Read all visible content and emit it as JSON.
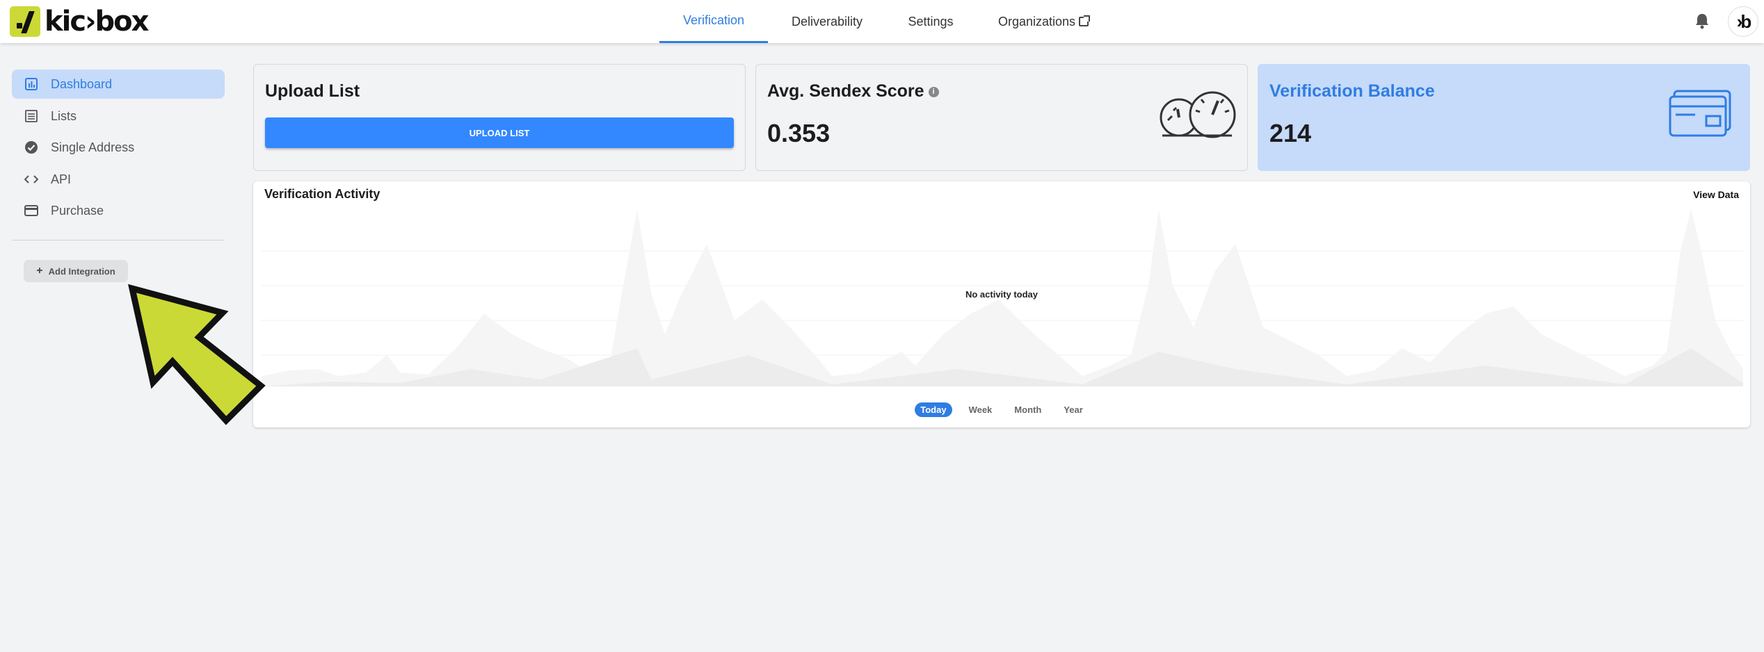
{
  "header": {
    "logo_text": "kic›box",
    "nav": [
      {
        "label": "Verification",
        "active": true
      },
      {
        "label": "Deliverability",
        "active": false
      },
      {
        "label": "Settings",
        "active": false
      },
      {
        "label": "Organizations",
        "active": false
      }
    ],
    "avatar_text": "›b",
    "bell_icon": "bell-icon"
  },
  "sidebar": {
    "items": [
      {
        "label": "Dashboard",
        "icon": "chart-icon",
        "active": true
      },
      {
        "label": "Lists",
        "icon": "list-icon",
        "active": false
      },
      {
        "label": "Single Address",
        "icon": "check-circle-icon",
        "active": false
      },
      {
        "label": "API",
        "icon": "code-icon",
        "active": false
      },
      {
        "label": "Purchase",
        "icon": "card-icon",
        "active": false
      }
    ],
    "add_integration_label": "Add Integration"
  },
  "cards": {
    "upload": {
      "title": "Upload List",
      "button_label": "UPLOAD LIST"
    },
    "sendex": {
      "title": "Avg. Sendex Score",
      "value": "0.353"
    },
    "balance": {
      "title": "Verification Balance",
      "value": "214"
    }
  },
  "activity": {
    "title": "Verification Activity",
    "view_data_label": "View Data",
    "empty_message": "No activity today",
    "ranges": [
      {
        "label": "Today",
        "active": true
      },
      {
        "label": "Week",
        "active": false
      },
      {
        "label": "Month",
        "active": false
      },
      {
        "label": "Year",
        "active": false
      }
    ]
  },
  "colors": {
    "accent": "#2f7de1",
    "button": "#3388ff",
    "active_bg": "#c6dafa",
    "logo": "#cbd937",
    "annotation_arrow": "#cbd937"
  }
}
